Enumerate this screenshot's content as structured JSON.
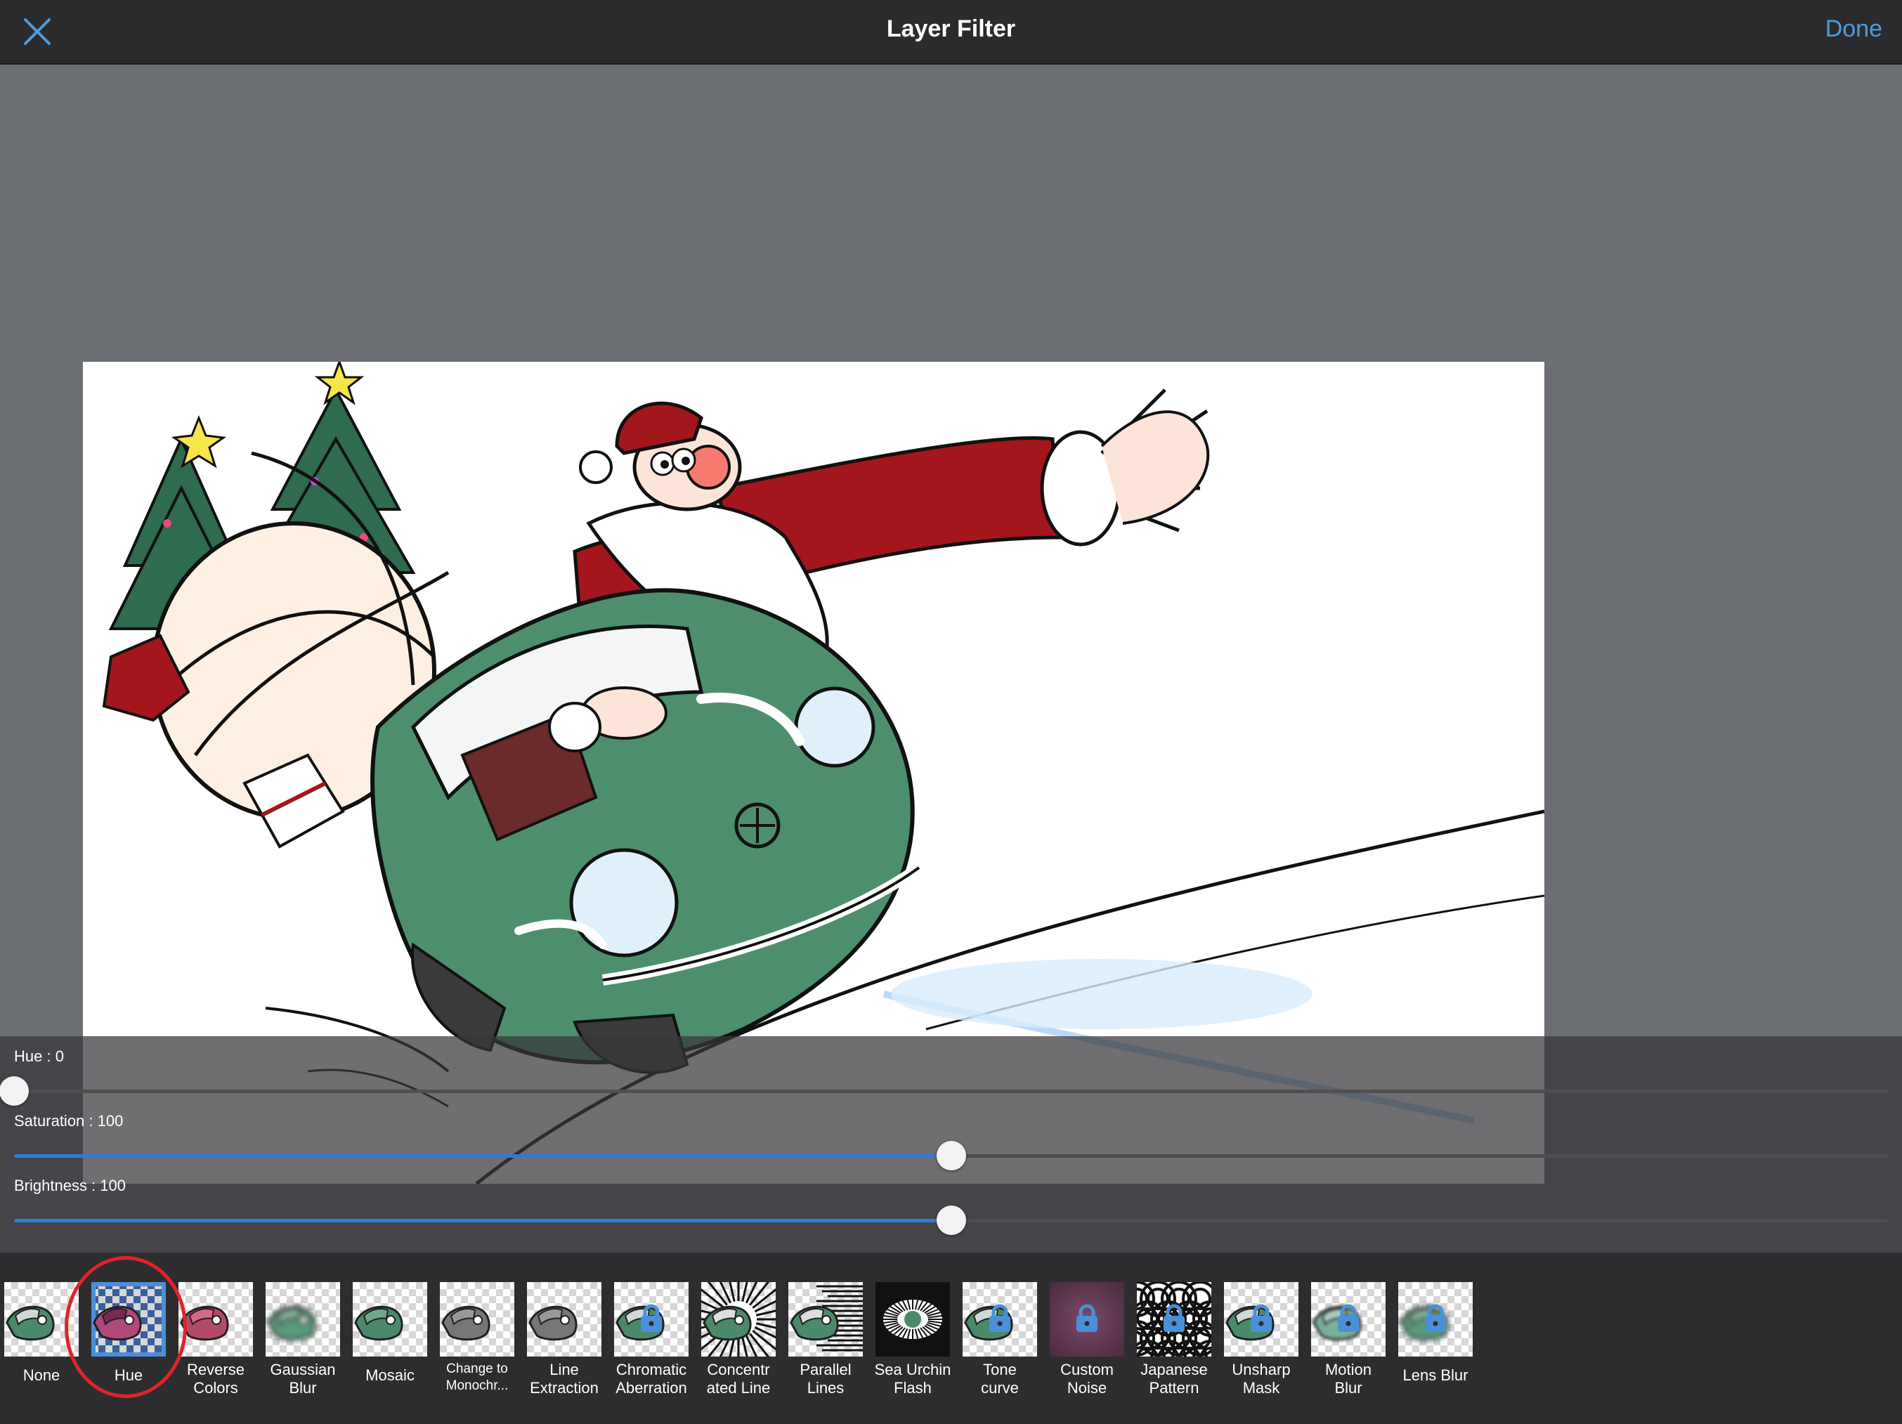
{
  "header": {
    "title": "Layer Filter",
    "done_label": "Done",
    "close_icon": "close-icon"
  },
  "colors": {
    "accent": "#4a9de0",
    "slider_fill": "#2f7bd8",
    "selection_circle": "#e0242a",
    "topbar_bg": "#2b2b2d",
    "workspace_bg": "#6b6e73"
  },
  "canvas": {
    "artwork": "santa-car-illustration"
  },
  "sliders": [
    {
      "label": "Hue : 0",
      "value": 0,
      "min": 0,
      "max": 360
    },
    {
      "label": "Saturation : 100",
      "value": 100,
      "min": 0,
      "max": 200
    },
    {
      "label": "Brightness : 100",
      "value": 100,
      "min": 0,
      "max": 200
    }
  ],
  "filters": [
    {
      "label": "None",
      "locked": false,
      "selected": false,
      "style": "normal"
    },
    {
      "label": "Hue",
      "locked": false,
      "selected": true,
      "style": "hue"
    },
    {
      "label": "Reverse\nColors",
      "locked": false,
      "selected": false,
      "style": "reverse"
    },
    {
      "label": "Gaussian\nBlur",
      "locked": false,
      "selected": false,
      "style": "blur"
    },
    {
      "label": "Mosaic",
      "locked": false,
      "selected": false,
      "style": "mosaic"
    },
    {
      "label": "Change to\nMonochr...",
      "locked": false,
      "selected": false,
      "style": "mono"
    },
    {
      "label": "Line\nExtraction",
      "locked": false,
      "selected": false,
      "style": "mono"
    },
    {
      "label": "Chromatic\nAberration",
      "locked": true,
      "selected": false,
      "style": "normal"
    },
    {
      "label": "Concentr\nated Line",
      "locked": false,
      "selected": false,
      "style": "concentrated"
    },
    {
      "label": "Parallel\nLines",
      "locked": false,
      "selected": false,
      "style": "parallel"
    },
    {
      "label": "Sea Urchin\nFlash",
      "locked": false,
      "selected": false,
      "style": "urchin"
    },
    {
      "label": "Tone\ncurve",
      "locked": true,
      "selected": false,
      "style": "normal"
    },
    {
      "label": "Custom\nNoise",
      "locked": true,
      "selected": false,
      "style": "noise"
    },
    {
      "label": "Japanese\nPattern",
      "locked": true,
      "selected": false,
      "style": "japanese"
    },
    {
      "label": "Unsharp\nMask",
      "locked": true,
      "selected": false,
      "style": "normal"
    },
    {
      "label": "Motion\nBlur",
      "locked": true,
      "selected": false,
      "style": "motion"
    },
    {
      "label": "Lens Blur",
      "locked": true,
      "selected": false,
      "style": "blur"
    }
  ]
}
